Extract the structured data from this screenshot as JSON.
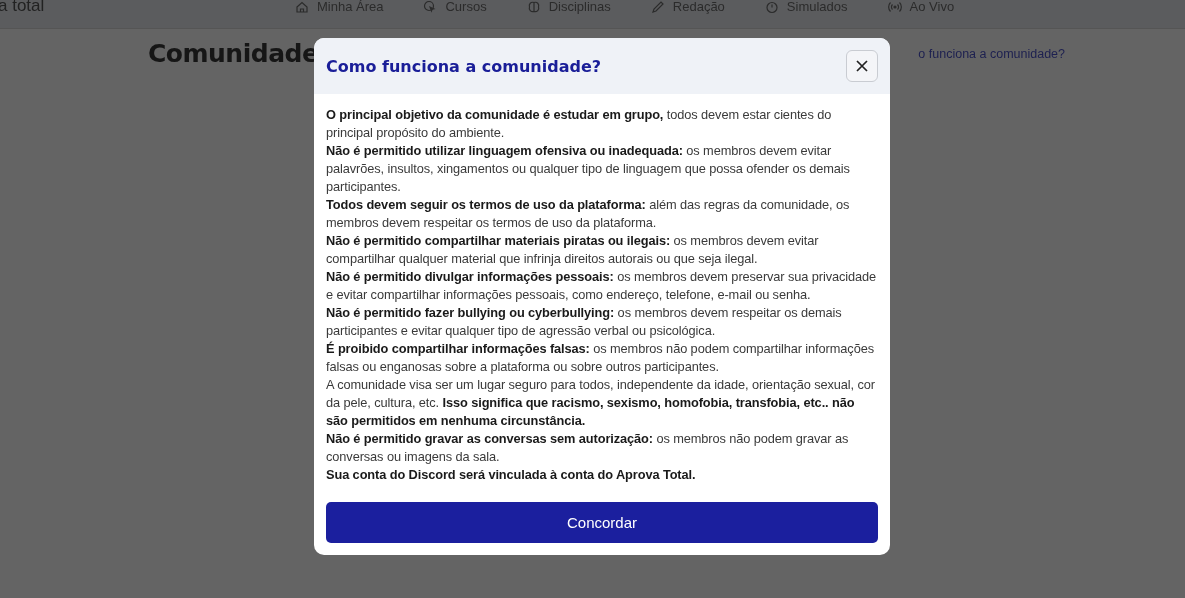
{
  "header": {
    "logo": "a total",
    "nav": [
      {
        "label": "Minha Área"
      },
      {
        "label": "Cursos"
      },
      {
        "label": "Disciplinas"
      },
      {
        "label": "Redação"
      },
      {
        "label": "Simulados"
      },
      {
        "label": "Ao Vivo"
      }
    ]
  },
  "page": {
    "title": "Comunidade",
    "help_link": "o funciona a comunidade?"
  },
  "modal": {
    "title": "Como funciona a comunidade?",
    "rules": [
      "**O principal objetivo da comunidade é estudar em grupo,** todos devem estar cientes do principal propósito do ambiente.",
      "**Não é permitido utilizar linguagem ofensiva ou inadequada:** os membros devem evitar palavrões, insultos, xingamentos ou qualquer tipo de linguagem que possa ofender os demais participantes.",
      "**Todos devem seguir os termos de uso da plataforma:** além das regras da comunidade, os membros devem respeitar os termos de uso da plataforma.",
      "**Não é permitido compartilhar materiais piratas ou ilegais:** os membros devem evitar compartilhar qualquer material que infrinja direitos autorais ou que seja ilegal.",
      "**Não é permitido divulgar informações pessoais:** os membros devem preservar sua privacidade e evitar compartilhar informações pessoais, como endereço, telefone, e-mail ou senha.",
      "**Não é permitido fazer bullying ou cyberbullying:** os membros devem respeitar os demais participantes e evitar qualquer tipo de agressão verbal ou psicológica.",
      "**É proibido compartilhar informações falsas:** os membros não podem compartilhar informações falsas ou enganosas sobre a plataforma ou sobre outros participantes.",
      "A comunidade visa ser um lugar seguro para todos, independente da idade, orientação sexual, cor da pele, cultura, etc. **Isso significa que racismo, sexismo, homofobia, transfobia, etc.. não são permitidos em nenhuma circunstância.**",
      "**Não é permitido gravar as conversas sem autorização:** os membros não podem gravar as conversas ou imagens da sala.",
      "**Sua conta do Discord será vinculada à conta do Aprova Total.**"
    ],
    "button": "Concordar"
  }
}
